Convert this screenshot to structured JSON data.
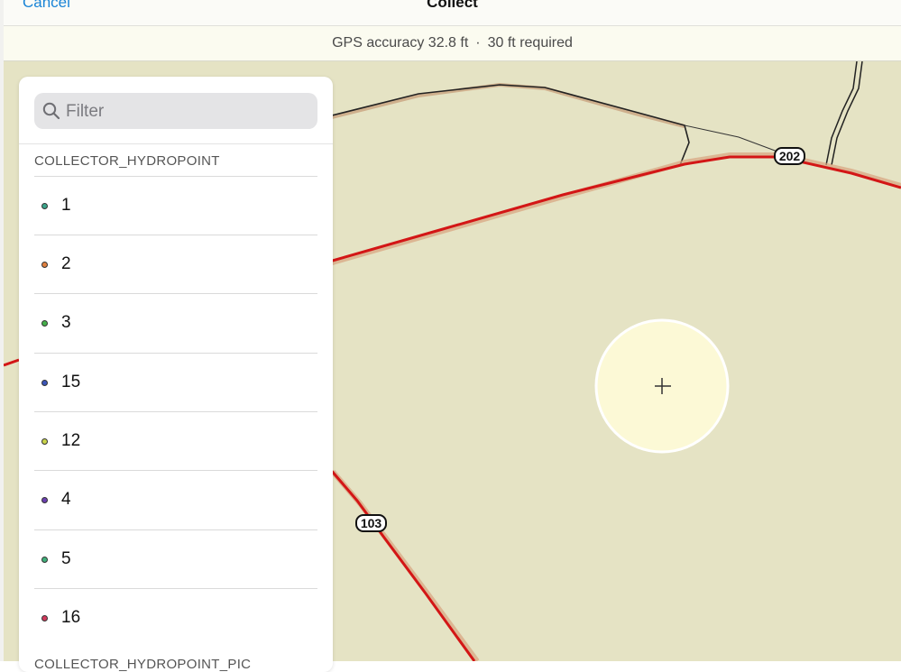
{
  "nav": {
    "cancel_label": "Cancel",
    "title": "Collect"
  },
  "gps": {
    "accuracy_text": "GPS accuracy 32.8 ft",
    "separator": "·",
    "required_text": "30 ft required"
  },
  "map": {
    "background_color": "#e5e3c4",
    "road_color": "#d31616",
    "shields": [
      {
        "label": "202"
      },
      {
        "label": "103"
      }
    ],
    "crosshair_symbol": "+"
  },
  "panel": {
    "filter_placeholder": "Filter",
    "filter_value": "",
    "sections": [
      {
        "header": "COLLECTOR_HYDROPOINT",
        "items": [
          {
            "label": "1",
            "color": "#3aa48a",
            "icon": "point-symbol"
          },
          {
            "label": "2",
            "color": "#e0803f",
            "icon": "point-symbol"
          },
          {
            "label": "3",
            "color": "#44b04a",
            "icon": "point-symbol"
          },
          {
            "label": "15",
            "color": "#3b55b8",
            "icon": "point-symbol"
          },
          {
            "label": "12",
            "color": "#c9d44a",
            "icon": "point-symbol"
          },
          {
            "label": "4",
            "color": "#6b3fb0",
            "icon": "point-symbol"
          },
          {
            "label": "5",
            "color": "#3fb07a",
            "icon": "point-symbol"
          },
          {
            "label": "16",
            "color": "#d13a5c",
            "icon": "point-symbol"
          }
        ]
      },
      {
        "header": "COLLECTOR_HYDROPOINT_PIC",
        "items": []
      }
    ]
  }
}
